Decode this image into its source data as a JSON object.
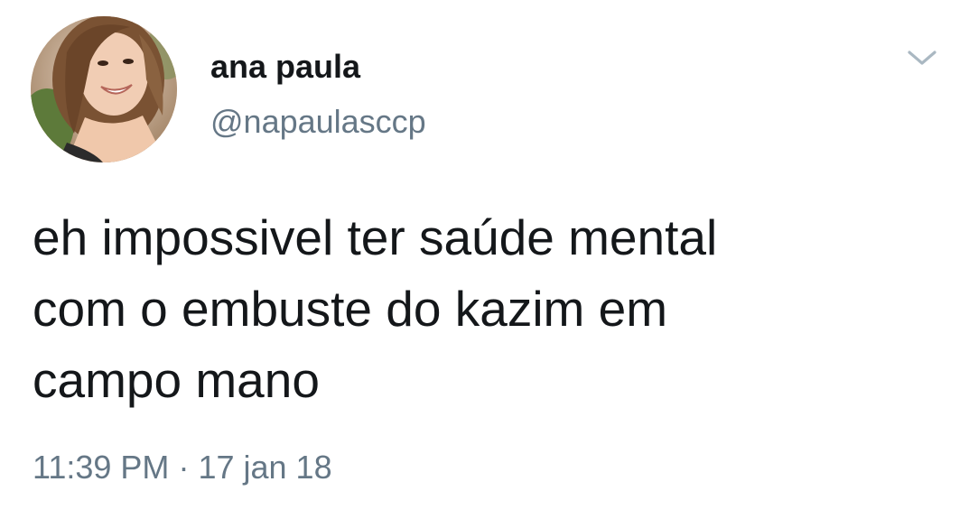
{
  "author": {
    "display_name": "ana paula",
    "handle": "@napaulasccp"
  },
  "icons": {
    "avatar": "profile-photo",
    "menu": "chevron-down-icon"
  },
  "tweet": {
    "lines": [
      "eh impossivel ter saúde mental",
      "com o embuste do kazim em",
      "campo mano"
    ],
    "time": "11:39 PM",
    "separator": "·",
    "date": "17 jan 18"
  },
  "colors": {
    "text": "#14171a",
    "secondary": "#657786",
    "background": "#ffffff"
  }
}
